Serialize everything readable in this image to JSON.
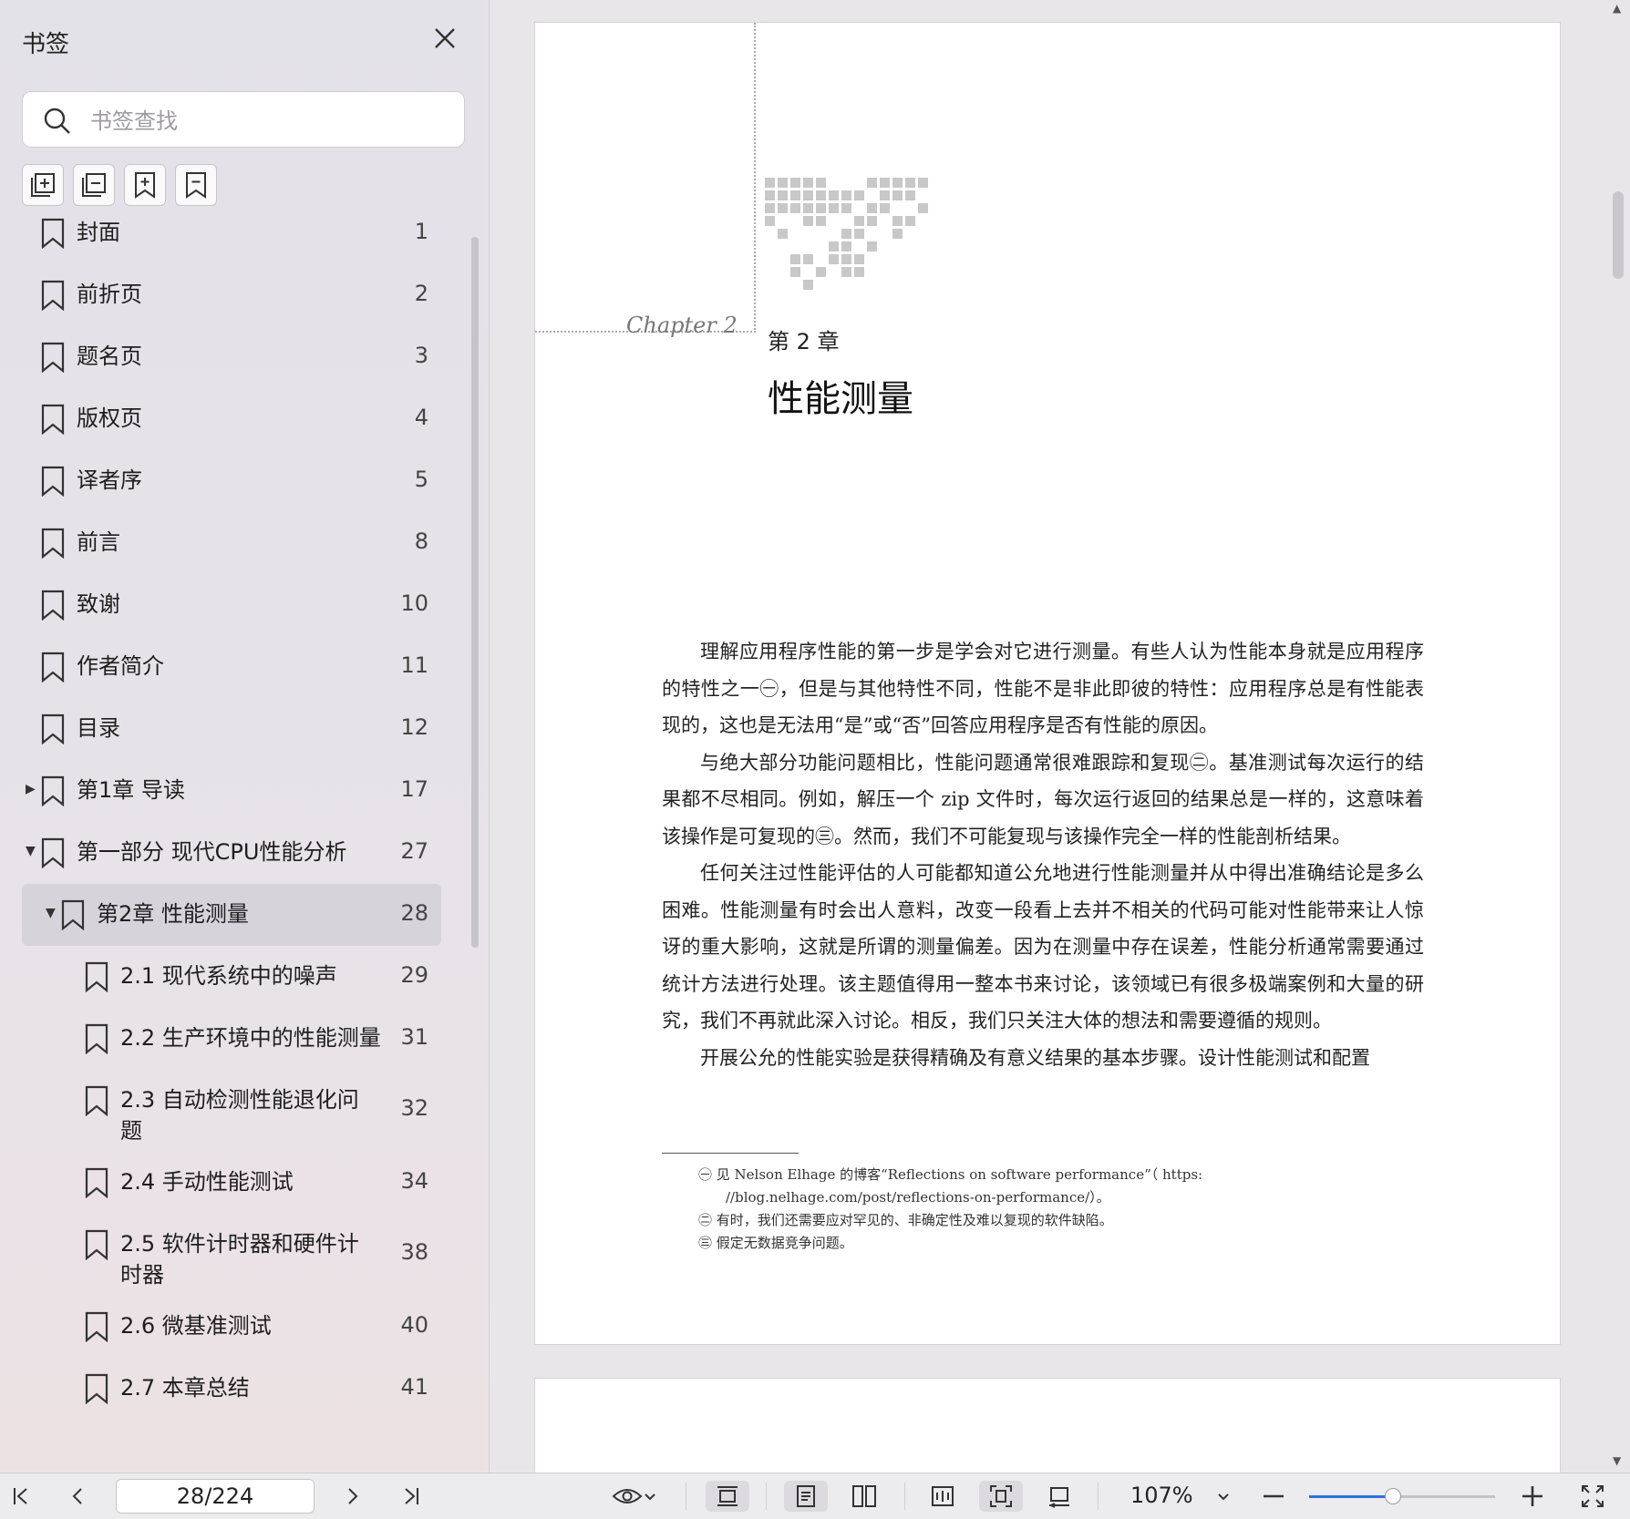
{
  "sidebar": {
    "title": "书签",
    "search_placeholder": "书签查找",
    "tools": [
      "expand-all-icon",
      "collapse-all-icon",
      "add-bookmark-icon",
      "remove-bookmark-icon"
    ],
    "items": [
      {
        "label": "封面",
        "page": "1",
        "level": 0,
        "toggle": ""
      },
      {
        "label": "前折页",
        "page": "2",
        "level": 0,
        "toggle": ""
      },
      {
        "label": "题名页",
        "page": "3",
        "level": 0,
        "toggle": ""
      },
      {
        "label": "版权页",
        "page": "4",
        "level": 0,
        "toggle": ""
      },
      {
        "label": "译者序",
        "page": "5",
        "level": 0,
        "toggle": ""
      },
      {
        "label": "前言",
        "page": "8",
        "level": 0,
        "toggle": ""
      },
      {
        "label": "致谢",
        "page": "10",
        "level": 0,
        "toggle": ""
      },
      {
        "label": "作者简介",
        "page": "11",
        "level": 0,
        "toggle": ""
      },
      {
        "label": "目录",
        "page": "12",
        "level": 0,
        "toggle": ""
      },
      {
        "label": "第1章  导读",
        "page": "17",
        "level": 0,
        "toggle": "collapsed"
      },
      {
        "label": "第一部分  现代CPU性能分析",
        "page": "27",
        "level": 0,
        "toggle": "expanded"
      },
      {
        "label": "第2章  性能测量",
        "page": "28",
        "level": 1,
        "toggle": "expanded",
        "selected": true
      },
      {
        "label": "2.1 现代系统中的噪声",
        "page": "29",
        "level": 2,
        "toggle": ""
      },
      {
        "label": "2.2 生产环境中的性能测量",
        "page": "31",
        "level": 2,
        "toggle": ""
      },
      {
        "label": "2.3 自动检测性能退化问题",
        "page": "32",
        "level": 2,
        "toggle": "",
        "lines": [
          "2.3 自动检测性能退化问",
          "题"
        ]
      },
      {
        "label": "2.4 手动性能测试",
        "page": "34",
        "level": 2,
        "toggle": ""
      },
      {
        "label": "2.5 软件计时器和硬件计时器",
        "page": "38",
        "level": 2,
        "toggle": "",
        "lines": [
          "2.5 软件计时器和硬件计",
          "时器"
        ]
      },
      {
        "label": "2.6 微基准测试",
        "page": "40",
        "level": 2,
        "toggle": ""
      },
      {
        "label": "2.7 本章总结",
        "page": "41",
        "level": 2,
        "toggle": ""
      }
    ]
  },
  "document": {
    "chapter_script": "Chapter 2",
    "chapter_number": "第 2 章",
    "chapter_title": "性能测量",
    "paragraphs": [
      "理解应用程序性能的第一步是学会对它进行测量。有些人认为性能本身就是应用程序的特性之一㊀，但是与其他特性不同，性能不是非此即彼的特性：应用程序总是有性能表现的，这也是无法用“是”或“否”回答应用程序是否有性能的原因。",
      "与绝大部分功能问题相比，性能问题通常很难跟踪和复现㊁。基准测试每次运行的结果都不尽相同。例如，解压一个 zip 文件时，每次运行返回的结果总是一样的，这意味着该操作是可复现的㊂。然而，我们不可能复现与该操作完全一样的性能剖析结果。",
      "任何关注过性能评估的人可能都知道公允地进行性能测量并从中得出准确结论是多么困难。性能测量有时会出人意料，改变一段看上去并不相关的代码可能对性能带来让人惊讶的重大影响，这就是所谓的测量偏差。因为在测量中存在误差，性能分析通常需要通过统计方法进行处理。该主题值得用一整本书来讨论，该领域已有很多极端案例和大量的研究，我们不再就此深入讨论。相反，我们只关注大体的想法和需要遵循的规则。",
      "开展公允的性能实验是获得精确及有意义结果的基本步骤。设计性能测试和配置"
    ],
    "footnotes": [
      "㊀  见 Nelson Elhage 的博客“Reflections on software performance”（ https: //blog.nelhage.com/post/reflections-on-performance/）。",
      "㊁  有时，我们还需要应对罕见的、非确定性及难以复现的软件缺陷。",
      "㊂  假定无数据竞争问题。"
    ]
  },
  "toolbar": {
    "page_indicator": "28/224",
    "zoom": "107%",
    "zoom_fraction": 0.45,
    "accent": "#2f6fe0"
  }
}
